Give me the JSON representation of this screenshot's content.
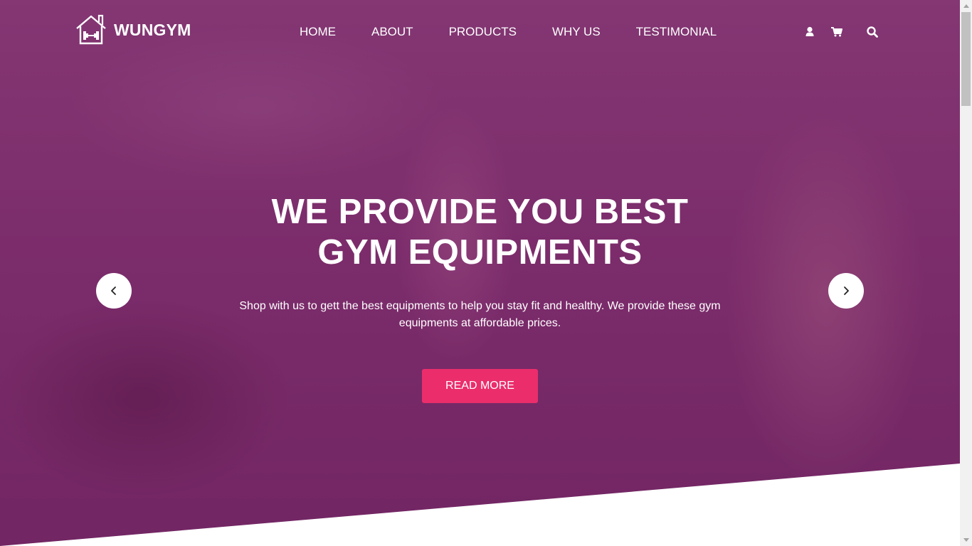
{
  "brand": {
    "name": "WUNGYM",
    "logo_icon": "house-dumbbell-icon"
  },
  "nav": {
    "items": [
      {
        "label": "HOME"
      },
      {
        "label": "ABOUT"
      },
      {
        "label": "PRODUCTS"
      },
      {
        "label": "WHY US"
      },
      {
        "label": "TESTIMONIAL"
      }
    ],
    "icons": [
      "user-icon",
      "cart-icon",
      "search-icon"
    ]
  },
  "hero": {
    "title_line1": "WE PROVIDE YOU BEST",
    "title_line2": "GYM EQUIPMENTS",
    "description": "Shop with us to gett the best equipments to help you stay fit and healthy. We provide these gym equipments at affordable prices.",
    "button_label": "READ MORE"
  },
  "carousel": {
    "prev_icon": "chevron-left-icon",
    "next_icon": "chevron-right-icon"
  },
  "colors": {
    "overlay": "#7e2f6c",
    "accent": "#eb2d6c",
    "text": "#ffffff"
  }
}
